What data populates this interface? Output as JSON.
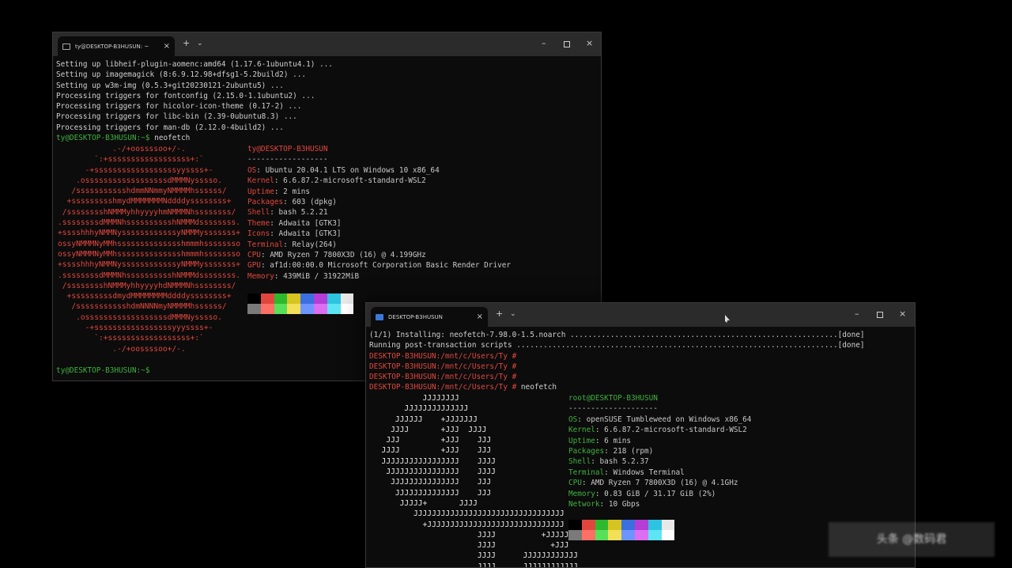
{
  "windows": [
    {
      "tab_title": "ty@DESKTOP-B3HUSUN: ~",
      "tab_close": "×",
      "new_tab": "+",
      "dropdown": "⌄",
      "minimize": "–",
      "close": "×",
      "lines": [
        {
          "text": "Setting up libheif-plugin-aomenc:amd64 (1.17.6-1ubuntu4.1) ...",
          "color": "gray"
        },
        {
          "text": "Setting up imagemagick (8:6.9.12.98+dfsg1-5.2build2) ...",
          "color": "gray"
        },
        {
          "text": "Setting up w3m-img (0.5.3+git20230121-2ubuntu5) ...",
          "color": "gray"
        },
        {
          "text": "Processing triggers for fontconfig (2.15.0-1.1ubuntu2) ...",
          "color": "gray"
        },
        {
          "text": "Processing triggers for hicolor-icon-theme (0.17-2) ...",
          "color": "gray"
        },
        {
          "text": "Processing triggers for libc-bin (2.39-0ubuntu8.3) ...",
          "color": "gray"
        },
        {
          "text": "Processing triggers for man-db (2.12.0-4build2) ...",
          "color": "gray"
        }
      ],
      "prompt": "ty@DESKTOP-B3HUSUN:~$",
      "command": " neofetch",
      "ascii_art": [
        "            .-/+oossssoo+/-.",
        "        `:+ssssssssssssssssss+:`",
        "      -+ssssssssssssssssssyyssss+-",
        "    .ossssssssssssssssssdMMMNysssso.",
        "   /ssssssssssshdmmNNmmyNMMMMhssssss/",
        "  +ssssssssshmydMMMMMMMNddddyssssssss+",
        " /sssssssshNMMMyhhyyyyhmNMMMNhssssssss/",
        ".ssssssssdMMMNhsssssssssshNMMMdssssssss.",
        "+sssshhhyNMMNyssssssssssssyNMMMysssssss+",
        "ossyNMMMNyMMhsssssssssssssshmmmhssssssso",
        "ossyNMMMNyMMhsssssssssssssshmmmhssssssso",
        "+sssshhhyNMMNyssssssssssssyNMMMysssssss+",
        ".ssssssssdMMMNhsssssssssshNMMMdssssssss.",
        " /sssssssshNMMMyhhyyyyhdNMMMNhssssssss/",
        "  +sssssssssdmydMMMMMMMMddddyssssssss+",
        "   /ssssssssssshdmNNNNmyNMMMMhssssss/",
        "    .ossssssssssssssssssdMMMNysssso.",
        "      -+sssssssssssssssssyyyssss+-",
        "        `:+ssssssssssssssssss+:`",
        "            .-/+oossssoo+/-."
      ],
      "info_title": "ty@DESKTOP-B3HUSUN",
      "info_sep": "------------------",
      "info": [
        {
          "key": "OS",
          "value": "Ubuntu 20.04.1 LTS on Windows 10 x86_64"
        },
        {
          "key": "Kernel",
          "value": "6.6.87.2-microsoft-standard-WSL2"
        },
        {
          "key": "Uptime",
          "value": "2 mins"
        },
        {
          "key": "Packages",
          "value": "603 (dpkg)"
        },
        {
          "key": "Shell",
          "value": "bash 5.2.21"
        },
        {
          "key": "Theme",
          "value": "Adwaita [GTK3]"
        },
        {
          "key": "Icons",
          "value": "Adwaita [GTK3]"
        },
        {
          "key": "Terminal",
          "value": "Relay(264)"
        },
        {
          "key": "CPU",
          "value": "AMD Ryzen 7 7800X3D (16) @ 4.199GHz"
        },
        {
          "key": "GPU",
          "value": "af1d:00:00.0 Microsoft Corporation Basic Render Driver"
        },
        {
          "key": "Memory",
          "value": "439MiB / 31922MiB"
        }
      ],
      "final_prompt": "ty@DESKTOP-B3HUSUN:~$"
    },
    {
      "tab_title": "DESKTOP-B3HUSUN",
      "tab_close": "×",
      "new_tab": "+",
      "dropdown": "⌄",
      "minimize": "–",
      "close": "×",
      "lines": [
        {
          "text": "(1/1) Installing: neofetch-7.98.0-1.5.noarch ............................................................[done]",
          "color": "gray"
        },
        {
          "text": "Running post-transaction scripts ........................................................................[done]",
          "color": "gray"
        },
        {
          "text": "DESKTOP-B3HUSUN:/mnt/c/Users/Ty #",
          "color": "red"
        },
        {
          "text": "DESKTOP-B3HUSUN:/mnt/c/Users/Ty #",
          "color": "red"
        },
        {
          "text": "DESKTOP-B3HUSUN:/mnt/c/Users/Ty #",
          "color": "red"
        }
      ],
      "prompt": "DESKTOP-B3HUSUN:/mnt/c/Users/Ty #",
      "command": " neofetch",
      "ascii_art": [
        "           JJJJJJJJ",
        "       JJJJJJJJJJJJJJ",
        "     JJJJJJ    +JJJJJJJ",
        "    JJJJ       +JJJ  JJJJ",
        "   JJJ         +JJJ    JJJ",
        "  JJJJ         +JJJ    JJJ",
        "  JJJJJJJJJJJJJJJJJ    JJJJ",
        "   JJJJJJJJJJJJJJJJ    JJJJ",
        "    JJJJJJJJJJJJJJJ    JJJ",
        "     JJJJJJJJJJJJJJ    JJJ",
        "      JJJJJ+       JJJJ",
        "         JJJJJJJJJJJJJJJJJJJJJJJJJJJJJJJJJ",
        "           +JJJJJJJJJJJJJJJJJJJJJJJJJJJJJJ",
        "                       JJJJ          +JJJJJJ",
        "                       JJJJ            +JJJ",
        "                       JJJJ      JJJJJJJJJJJJ",
        "                       JJJJ      JJJJJJJJJJJJ"
      ],
      "info_title": "root@DESKTOP-B3HUSUN",
      "info_sep": "--------------------",
      "info": [
        {
          "key": "OS",
          "value": "openSUSE Tumbleweed on Windows x86_64"
        },
        {
          "key": "Kernel",
          "value": "6.6.87.2-microsoft-standard-WSL2"
        },
        {
          "key": "Uptime",
          "value": "6 mins"
        },
        {
          "key": "Packages",
          "value": "218 (rpm)"
        },
        {
          "key": "Shell",
          "value": "bash 5.2.37"
        },
        {
          "key": "Terminal",
          "value": "Windows Terminal"
        },
        {
          "key": "CPU",
          "value": "AMD Ryzen 7 7800X3D (16) @ 4.1GHz"
        },
        {
          "key": "Memory",
          "value": "0.83 GiB / 31.17 GiB (2%)"
        },
        {
          "key": "Network",
          "value": "10 Gbps"
        }
      ]
    }
  ],
  "palette_top": [
    "#000000",
    "#e0463d",
    "#2eb82e",
    "#d6c421",
    "#3b6fe0",
    "#b43dd6",
    "#2ec3e0",
    "#e8e8e8"
  ],
  "palette_bottom": [
    "#7a7a7a",
    "#ff6f66",
    "#58e058",
    "#f2e056",
    "#6e95ff",
    "#dd6ef2",
    "#5ee5f5",
    "#ffffff"
  ],
  "watermark": "头条 @数码君"
}
